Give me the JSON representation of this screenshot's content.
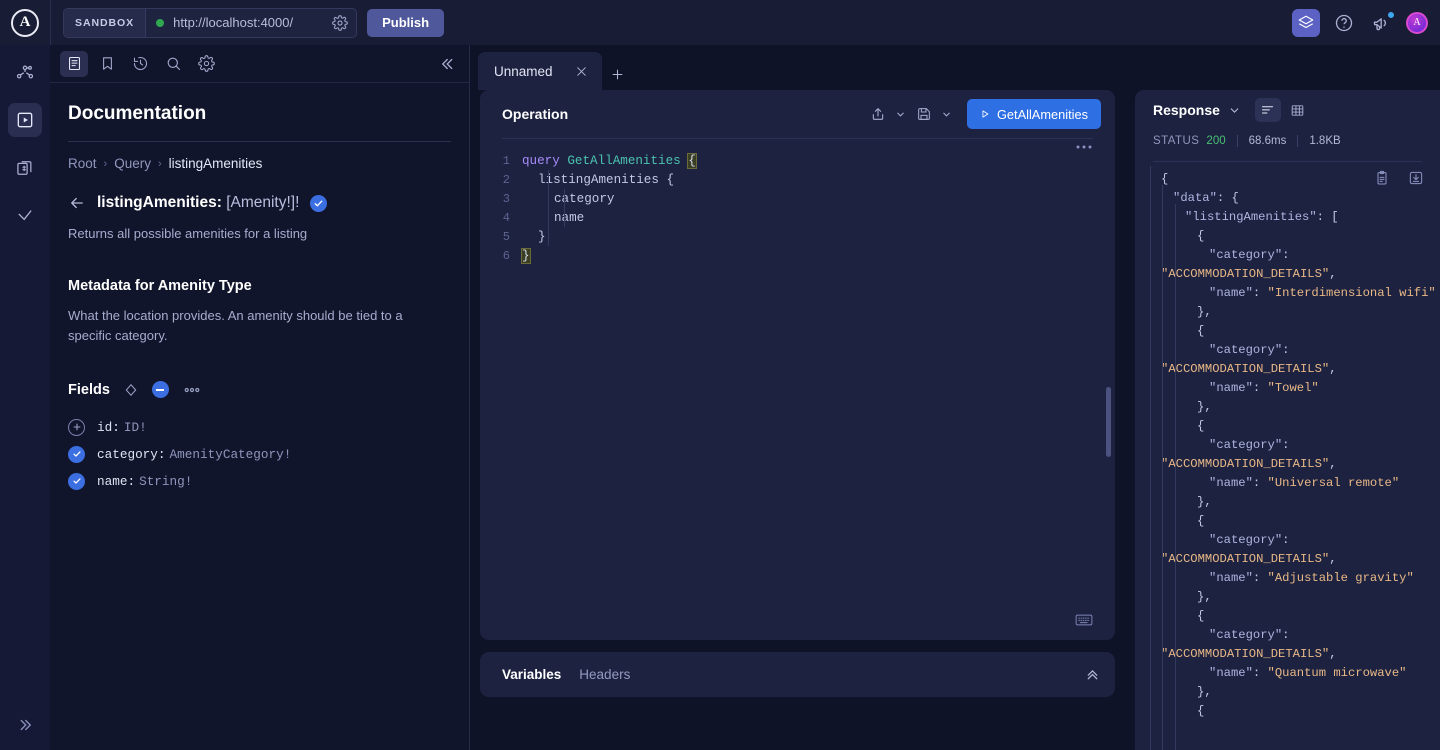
{
  "topbar": {
    "logo_letter": "A",
    "sandbox_label": "SANDBOX",
    "url": "http://localhost:4000/",
    "publish_label": "Publish",
    "icons": [
      "settings-gear-icon",
      "graph-cube-icon",
      "help-icon",
      "announcements-icon",
      "avatar"
    ],
    "accent_publish": "#50589c",
    "status_dot_color": "#2fa84f"
  },
  "rail": {
    "items": [
      {
        "name": "schema-graph-icon",
        "active": false
      },
      {
        "name": "explorer-icon",
        "active": true
      },
      {
        "name": "collections-icon",
        "active": false
      },
      {
        "name": "checks-icon",
        "active": false
      }
    ],
    "expand_label": "expand-sidebar"
  },
  "documentation": {
    "toolbar": [
      {
        "name": "docs-icon",
        "active": true
      },
      {
        "name": "bookmark-icon",
        "active": false
      },
      {
        "name": "history-icon",
        "active": false
      },
      {
        "name": "search-icon",
        "active": false
      },
      {
        "name": "settings-icon",
        "active": false
      }
    ],
    "collapse_icon": "chevrons-left-icon",
    "title": "Documentation",
    "breadcrumb": [
      "Root",
      "Query",
      "listingAmenities"
    ],
    "field_title_name": "listingAmenities: ",
    "field_title_type": "[Amenity!]!",
    "description": "Returns all possible amenities for a listing",
    "metadata_heading": "Metadata for Amenity Type",
    "metadata_text": "What the location provides. An amenity should be tied to a specific category.",
    "fields_label": "Fields",
    "fields": [
      {
        "name": "id: ",
        "type": "ID!",
        "selected": false
      },
      {
        "name": "category: ",
        "type": "AmenityCategory!",
        "selected": true
      },
      {
        "name": "name: ",
        "type": "String!",
        "selected": true
      }
    ]
  },
  "tabs": {
    "items": [
      {
        "label": "Unnamed",
        "active": true
      }
    ],
    "add_label": "new-tab"
  },
  "operation": {
    "title": "Operation",
    "run_label": "GetAllAmenities",
    "run_color": "#2f6fe4",
    "code_lines": [
      {
        "n": "1",
        "indent": 0,
        "tokens": [
          {
            "t": "query ",
            "c": "kw"
          },
          {
            "t": "GetAllAmenities",
            "c": "fname"
          },
          {
            "t": " ",
            "c": "prop"
          },
          {
            "t": "{",
            "c": "brace-hl"
          }
        ]
      },
      {
        "n": "2",
        "indent": 1,
        "tokens": [
          {
            "t": "listingAmenities {",
            "c": "prop"
          }
        ]
      },
      {
        "n": "3",
        "indent": 2,
        "tokens": [
          {
            "t": "category",
            "c": "prop"
          }
        ]
      },
      {
        "n": "4",
        "indent": 2,
        "tokens": [
          {
            "t": "name",
            "c": "prop"
          }
        ]
      },
      {
        "n": "5",
        "indent": 1,
        "tokens": [
          {
            "t": "}",
            "c": "prop"
          }
        ]
      },
      {
        "n": "6",
        "indent": 0,
        "tokens": [
          {
            "t": "}",
            "c": "brace-hl"
          }
        ]
      }
    ]
  },
  "variables": {
    "tabs": [
      "Variables",
      "Headers"
    ],
    "expand_icon": "chevrons-up-icon"
  },
  "response": {
    "title": "Response",
    "view_modes": [
      "json-view-icon",
      "table-view-icon"
    ],
    "status_label": "STATUS",
    "status_code": "200",
    "status_color": "#49c173",
    "duration": "68.6ms",
    "size": "1.8KB",
    "copy_icon": "clipboard-icon",
    "download_icon": "download-icon",
    "json_lines": [
      {
        "indent": 0,
        "parts": [
          {
            "t": "{",
            "c": "jbrace"
          }
        ]
      },
      {
        "indent": 1,
        "parts": [
          {
            "t": "\"data\"",
            "c": "jkey"
          },
          {
            "t": ": {",
            "c": "jpunct"
          }
        ]
      },
      {
        "indent": 2,
        "parts": [
          {
            "t": "\"listingAmenities\"",
            "c": "jkey"
          },
          {
            "t": ": [",
            "c": "jpunct"
          }
        ]
      },
      {
        "indent": 3,
        "parts": [
          {
            "t": "{",
            "c": "jpunct"
          }
        ]
      },
      {
        "indent": 4,
        "parts": [
          {
            "t": "\"category\"",
            "c": "jkey"
          },
          {
            "t": ": ",
            "c": "jpunct"
          },
          {
            "t": "\"ACCOMMODATION_DETAILS\"",
            "c": "jstr"
          },
          {
            "t": ",",
            "c": "jpunct"
          }
        ]
      },
      {
        "indent": 4,
        "parts": [
          {
            "t": "\"name\"",
            "c": "jkey"
          },
          {
            "t": ": ",
            "c": "jpunct"
          },
          {
            "t": "\"Interdimensional wifi\"",
            "c": "jstr"
          }
        ]
      },
      {
        "indent": 3,
        "parts": [
          {
            "t": "},",
            "c": "jpunct"
          }
        ]
      },
      {
        "indent": 3,
        "parts": [
          {
            "t": "{",
            "c": "jpunct"
          }
        ]
      },
      {
        "indent": 4,
        "parts": [
          {
            "t": "\"category\"",
            "c": "jkey"
          },
          {
            "t": ": ",
            "c": "jpunct"
          },
          {
            "t": "\"ACCOMMODATION_DETAILS\"",
            "c": "jstr"
          },
          {
            "t": ",",
            "c": "jpunct"
          }
        ]
      },
      {
        "indent": 4,
        "parts": [
          {
            "t": "\"name\"",
            "c": "jkey"
          },
          {
            "t": ": ",
            "c": "jpunct"
          },
          {
            "t": "\"Towel\"",
            "c": "jstr"
          }
        ]
      },
      {
        "indent": 3,
        "parts": [
          {
            "t": "},",
            "c": "jpunct"
          }
        ]
      },
      {
        "indent": 3,
        "parts": [
          {
            "t": "{",
            "c": "jpunct"
          }
        ]
      },
      {
        "indent": 4,
        "parts": [
          {
            "t": "\"category\"",
            "c": "jkey"
          },
          {
            "t": ": ",
            "c": "jpunct"
          },
          {
            "t": "\"ACCOMMODATION_DETAILS\"",
            "c": "jstr"
          },
          {
            "t": ",",
            "c": "jpunct"
          }
        ]
      },
      {
        "indent": 4,
        "parts": [
          {
            "t": "\"name\"",
            "c": "jkey"
          },
          {
            "t": ": ",
            "c": "jpunct"
          },
          {
            "t": "\"Universal remote\"",
            "c": "jstr"
          }
        ]
      },
      {
        "indent": 3,
        "parts": [
          {
            "t": "},",
            "c": "jpunct"
          }
        ]
      },
      {
        "indent": 3,
        "parts": [
          {
            "t": "{",
            "c": "jpunct"
          }
        ]
      },
      {
        "indent": 4,
        "parts": [
          {
            "t": "\"category\"",
            "c": "jkey"
          },
          {
            "t": ": ",
            "c": "jpunct"
          },
          {
            "t": "\"ACCOMMODATION_DETAILS\"",
            "c": "jstr"
          },
          {
            "t": ",",
            "c": "jpunct"
          }
        ]
      },
      {
        "indent": 4,
        "parts": [
          {
            "t": "\"name\"",
            "c": "jkey"
          },
          {
            "t": ": ",
            "c": "jpunct"
          },
          {
            "t": "\"Adjustable gravity\"",
            "c": "jstr"
          }
        ]
      },
      {
        "indent": 3,
        "parts": [
          {
            "t": "},",
            "c": "jpunct"
          }
        ]
      },
      {
        "indent": 3,
        "parts": [
          {
            "t": "{",
            "c": "jpunct"
          }
        ]
      },
      {
        "indent": 4,
        "parts": [
          {
            "t": "\"category\"",
            "c": "jkey"
          },
          {
            "t": ": ",
            "c": "jpunct"
          },
          {
            "t": "\"ACCOMMODATION_DETAILS\"",
            "c": "jstr"
          },
          {
            "t": ",",
            "c": "jpunct"
          }
        ]
      },
      {
        "indent": 4,
        "parts": [
          {
            "t": "\"name\"",
            "c": "jkey"
          },
          {
            "t": ": ",
            "c": "jpunct"
          },
          {
            "t": "\"Quantum microwave\"",
            "c": "jstr"
          }
        ]
      },
      {
        "indent": 3,
        "parts": [
          {
            "t": "},",
            "c": "jpunct"
          }
        ]
      },
      {
        "indent": 3,
        "parts": [
          {
            "t": "{",
            "c": "jpunct"
          }
        ]
      }
    ]
  }
}
